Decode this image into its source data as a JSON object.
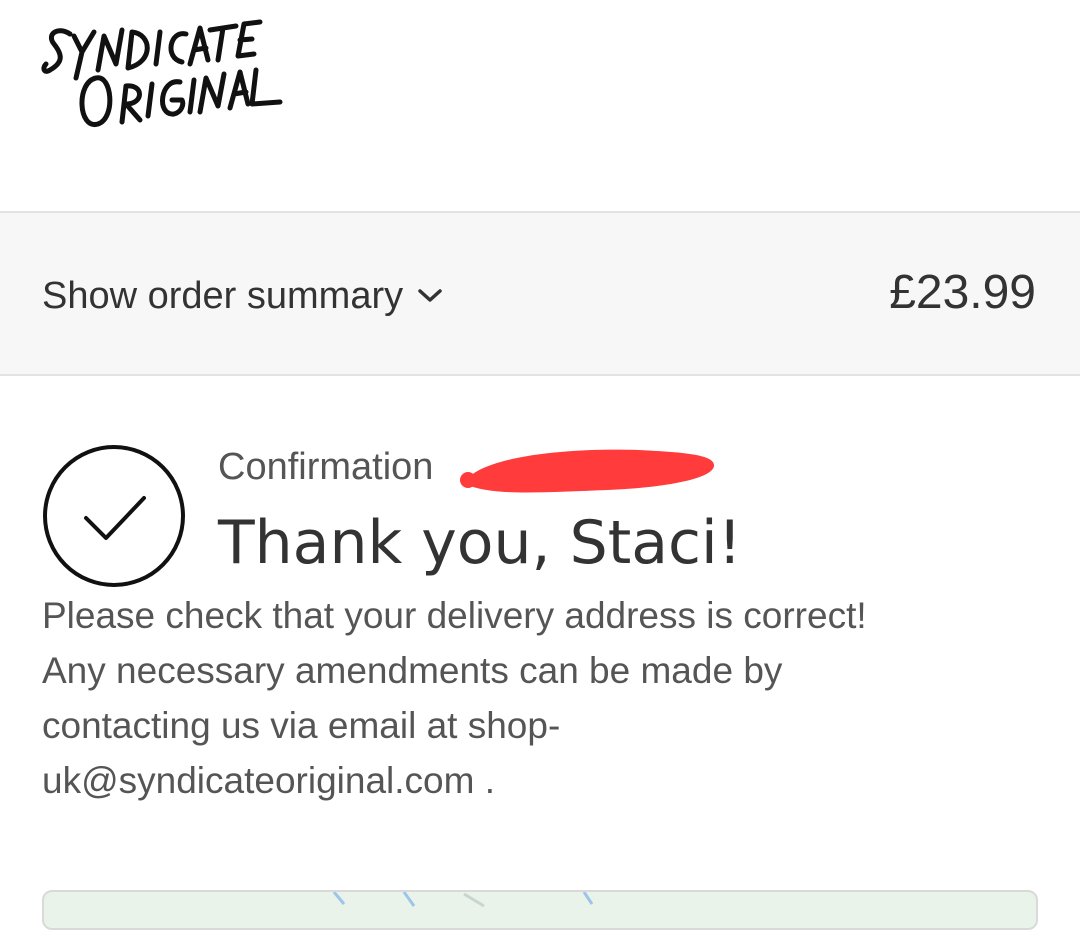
{
  "header": {
    "logo_text": "SYNDICATE ORIGINAL"
  },
  "summary": {
    "toggle_label": "Show order summary",
    "total": "£23.99"
  },
  "confirmation": {
    "label": "Confirmation",
    "greeting": "Thank you, Staci!",
    "message": "Please check that your delivery address is correct!\nAny necessary amendments can be made by\ncontacting us via email at shop-\nuk@syndicateoriginal.com ."
  },
  "colors": {
    "text_primary": "#333333",
    "text_secondary": "#555555",
    "summary_bg": "#f7f7f7",
    "redaction": "#ff3b3b"
  },
  "icons": {
    "summary_chevron": "chevron-down-icon",
    "confirmation_check": "checkmark-circle-icon"
  }
}
